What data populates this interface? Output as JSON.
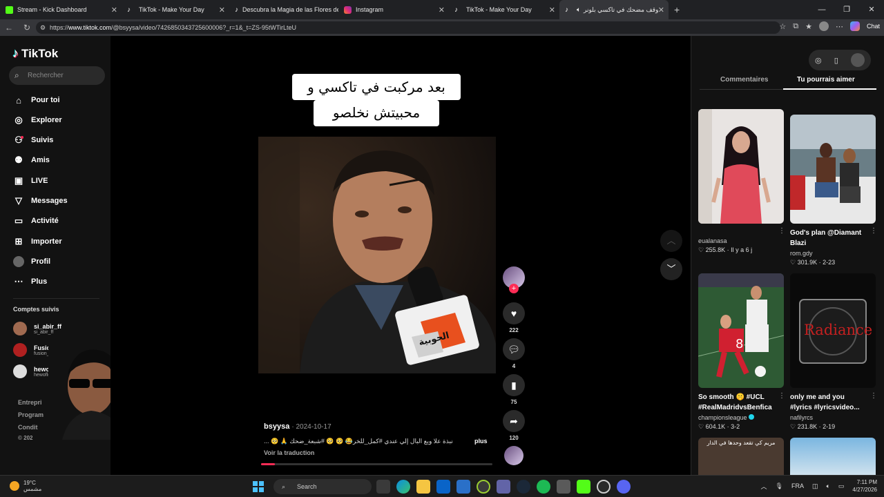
{
  "browser": {
    "tabs": [
      {
        "title": "Stream - Kick Dashboard",
        "icon": "kick-icon",
        "active": false
      },
      {
        "title": "TikTok - Make Your Day",
        "icon": "tiktok-icon",
        "active": false
      },
      {
        "title": "Descubra la Magia de las Flores de",
        "icon": "tiktok-icon",
        "active": false
      },
      {
        "title": "Instagram",
        "icon": "instagram-icon",
        "active": false
      },
      {
        "title": "TikTok - Make Your Day",
        "icon": "tiktok-icon",
        "active": false
      },
      {
        "title": "موقف مضحك في تاكسي بلونر",
        "icon": "tiktok-icon",
        "active": true
      }
    ],
    "url_prefix": "https://",
    "url_host": "www.tiktok.com",
    "url_path": "/@bsyysa/video/7426850343725600006?_r=1&_t=ZS-95tWTirLteU",
    "chat_label": "Chat"
  },
  "sidebar": {
    "logo": "TikTok",
    "search_placeholder": "Rechercher",
    "nav": [
      {
        "label": "Pour toi",
        "icon": "home-icon"
      },
      {
        "label": "Explorer",
        "icon": "compass-icon"
      },
      {
        "label": "Suivis",
        "icon": "following-icon"
      },
      {
        "label": "Amis",
        "icon": "friends-icon"
      },
      {
        "label": "LIVE",
        "icon": "live-icon"
      },
      {
        "label": "Messages",
        "icon": "messages-icon"
      },
      {
        "label": "Activité",
        "icon": "activity-icon"
      },
      {
        "label": "Importer",
        "icon": "upload-icon"
      },
      {
        "label": "Profil",
        "icon": "profile-icon"
      },
      {
        "label": "Plus",
        "icon": "more-icon"
      }
    ],
    "following_title": "Comptes suivis",
    "following": [
      {
        "name": "si_abir_ff",
        "handle": "si_abir_ff"
      },
      {
        "name": "Fusion",
        "handle": "fusion___10"
      },
      {
        "name": "hewoflgwq",
        "handle": "hewoflgwq"
      }
    ],
    "footer": [
      "Entrepri",
      "Program",
      "Condit",
      "© 202"
    ]
  },
  "video": {
    "caption_line1": "بعد مركبت في تاكسي و",
    "caption_line2": "محبيتش نخلصو",
    "mic_logo_text": "الحوبية",
    "author": "bsyysa",
    "date": "2024-10-17",
    "description": "نبذة علا ويع البال إلي عندي #كمل_للخر😂 🥺 🥺 #شبعة_ضحك 🙏 🥺 ...",
    "more_label": "plus",
    "translate_label": "Voir la traduction",
    "progress": 0.06,
    "likes": "222",
    "comments": "4",
    "saves": "75",
    "shares": "120"
  },
  "right_panel": {
    "tabs": [
      "Commentaires",
      "Tu pourrais aimer"
    ],
    "active_tab": 1,
    "cards": [
      {
        "title": "",
        "user": "eualanasa",
        "likes": "255.8K",
        "meta": "Il y a 6 j"
      },
      {
        "title": "God's plan @Diamant Blazi",
        "user": "rom.gdy",
        "likes": "301.9K",
        "meta": "2-23"
      },
      {
        "title": "So smooth 🤫 #UCL #RealMadridvsBenfica",
        "user": "championsleague",
        "likes": "604.1K",
        "meta": "3-2"
      },
      {
        "title": "only me and you #lyrics #lyricsvideo...",
        "user": "nafilyrcs",
        "likes": "231.8K",
        "meta": "2-19"
      }
    ],
    "partial_card_text": "مريم كي تقعد وحدها في الدار",
    "radiance_text": "Radiance"
  },
  "taskbar": {
    "temp": "19°C",
    "weather_text": "مشمس",
    "search_placeholder": "Search",
    "lang": "FRA",
    "time": "7:11 PM",
    "date": "4/27/2026"
  },
  "colors": {
    "accent": "#fe2c55",
    "tiktok_cyan": "#25f4ee",
    "kick_green": "#53fc18"
  }
}
